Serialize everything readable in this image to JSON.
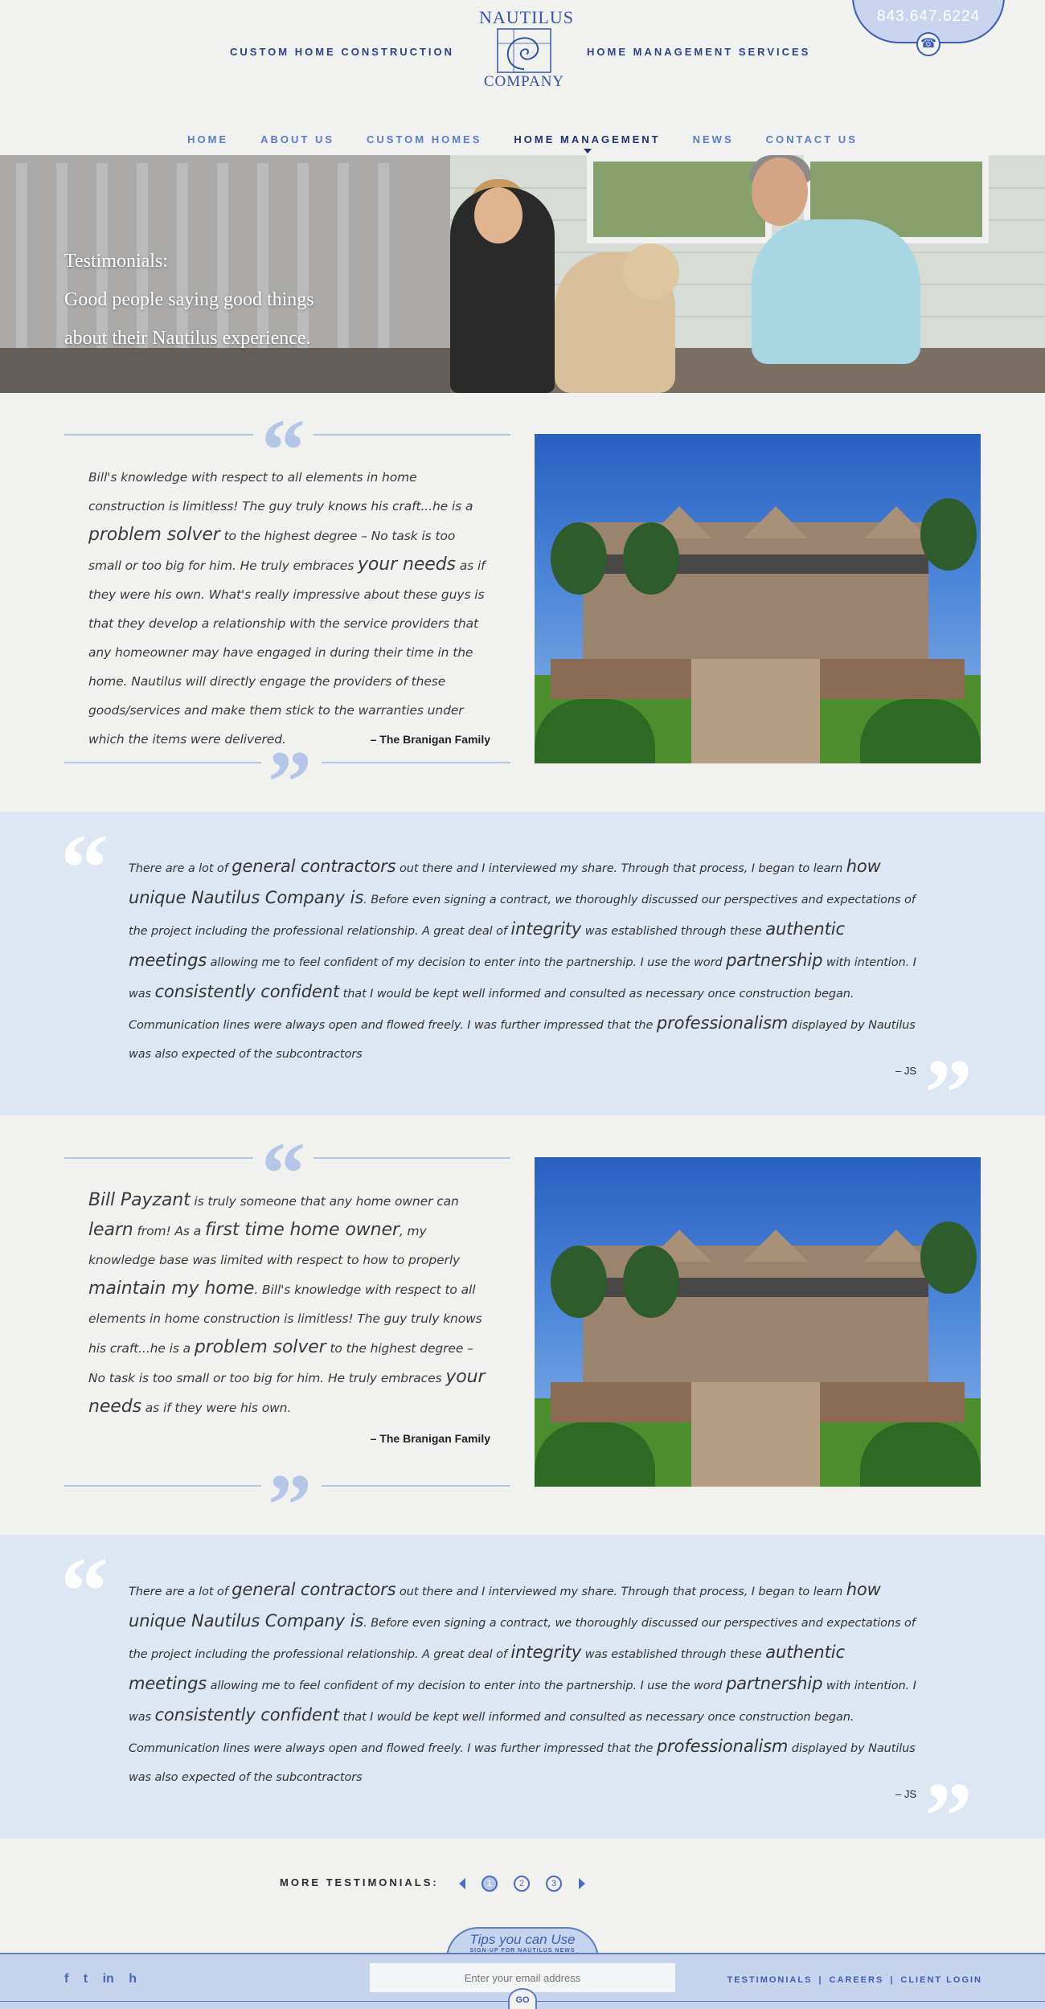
{
  "header": {
    "tag_left": "CUSTOM HOME CONSTRUCTION",
    "tag_right": "HOME MANAGEMENT SERVICES",
    "logo_word1": "NAUTILUS",
    "logo_word2": "COMPANY",
    "phone": "843.647.6224"
  },
  "nav": {
    "items": [
      {
        "label": "HOME"
      },
      {
        "label": "ABOUT US"
      },
      {
        "label": "CUSTOM HOMES"
      },
      {
        "label": "HOME MANAGEMENT",
        "active": true
      },
      {
        "label": "NEWS"
      },
      {
        "label": "CONTACT US"
      }
    ]
  },
  "hero": {
    "line1": "Testimonials:",
    "line2": "Good people saying good things",
    "line3": "about their Nautilus experience."
  },
  "testimonials": {
    "t1": {
      "text": [
        {
          "t": "Bill's knowledge with respect to all elements in home construction is limitless! The guy truly knows his craft...he is a "
        },
        {
          "t": "problem solver",
          "big": true
        },
        {
          "t": " to the highest degree – No task is too small or too big for him. He truly embraces "
        },
        {
          "t": "your needs",
          "big": true
        },
        {
          "t": " as if they were his own. What's really impressive about these guys is that they develop a relationship with the service providers that any homeowner may have engaged in during their time in the home. Nautilus will directly engage the providers of these goods/services and make them stick to the warranties under which the items were delivered."
        }
      ],
      "author": "– The Branigan Family"
    },
    "t2": {
      "text": [
        {
          "t": "There are a lot of "
        },
        {
          "t": "general contractors",
          "big": true
        },
        {
          "t": " out there and I interviewed my share. Through that process, I began to learn "
        },
        {
          "t": "how unique Nautilus Company is",
          "big": true
        },
        {
          "t": ". Before even signing a contract, we thoroughly discussed our perspectives and expectations of the project including the professional relationship. A great deal of "
        },
        {
          "t": "integrity",
          "big": true
        },
        {
          "t": " was established through these "
        },
        {
          "t": "authentic meetings",
          "big": true
        },
        {
          "t": " allowing me to feel confident of my decision to enter into the partnership. I use the word "
        },
        {
          "t": "partnership",
          "big": true
        },
        {
          "t": " with intention. I was "
        },
        {
          "t": "consistently confident",
          "big": true
        },
        {
          "t": " that I would be kept well informed and consulted as necessary once construction began. Communication lines were always open and flowed freely. I was further impressed that the "
        },
        {
          "t": "professionalism",
          "big": true
        },
        {
          "t": " displayed by Nautilus was also expected of the subcontractors"
        }
      ],
      "author": "– JS"
    },
    "t3": {
      "text": [
        {
          "t": "Bill Payzant",
          "big": true
        },
        {
          "t": " is truly someone that any home owner can "
        },
        {
          "t": "learn",
          "big": true
        },
        {
          "t": " from! As a "
        },
        {
          "t": "first time home owner",
          "big": true
        },
        {
          "t": ", my knowledge base was limited with respect to how to properly "
        },
        {
          "t": "maintain my home",
          "big": true
        },
        {
          "t": ". Bill's knowledge with respect to all elements in home construction is limitless! The guy truly knows his craft...he is a "
        },
        {
          "t": "problem solver",
          "big": true
        },
        {
          "t": " to the highest degree – No task is too small or too big for him. He truly embraces "
        },
        {
          "t": "your needs",
          "big": true
        },
        {
          "t": " as if they were his own."
        }
      ],
      "author": "– The Branigan Family"
    },
    "t4": {
      "text": [
        {
          "t": "There are a lot of "
        },
        {
          "t": "general contractors",
          "big": true
        },
        {
          "t": " out there and I interviewed my share. Through that process, I began to learn "
        },
        {
          "t": "how unique Nautilus Company is",
          "big": true
        },
        {
          "t": ". Before even signing a contract, we thoroughly discussed our perspectives and expectations of the project including the professional relationship. A great deal of "
        },
        {
          "t": "integrity",
          "big": true
        },
        {
          "t": " was established through these "
        },
        {
          "t": "authentic meetings",
          "big": true
        },
        {
          "t": " allowing me to feel confident of my decision to enter into the partnership. I use the word "
        },
        {
          "t": "partnership",
          "big": true
        },
        {
          "t": " with intention. I was "
        },
        {
          "t": "consistently confident",
          "big": true
        },
        {
          "t": " that I would be kept well informed and consulted as necessary once construction began. Communication lines were always open and flowed freely. I was further impressed that the "
        },
        {
          "t": "professionalism",
          "big": true
        },
        {
          "t": " displayed by Nautilus was also expected of the subcontractors"
        }
      ],
      "author": "– JS"
    }
  },
  "pagination": {
    "label": "MORE TESTIMONIALS:",
    "pages": [
      "1",
      "2",
      "3"
    ],
    "current": "1"
  },
  "footer": {
    "social_icons": [
      "facebook-icon",
      "twitter-icon",
      "linkedin-icon",
      "houzz-icon"
    ],
    "social_glyphs": [
      "f",
      "t",
      "in",
      "h"
    ],
    "tips_title": "Tips you can Use",
    "tips_sub": "SIGN-UP FOR NAUTILUS NEWS",
    "email_placeholder": "Enter your email address",
    "go_label": "GO",
    "links": [
      "TESTIMONIALS",
      "CAREERS",
      "CLIENT LOGIN"
    ]
  },
  "colors": {
    "accent_blue": "#3e5cb4",
    "light_blue_band": "#dde6f3",
    "quote_mark": "#b6c6e6",
    "background": "#f1f1f0"
  }
}
